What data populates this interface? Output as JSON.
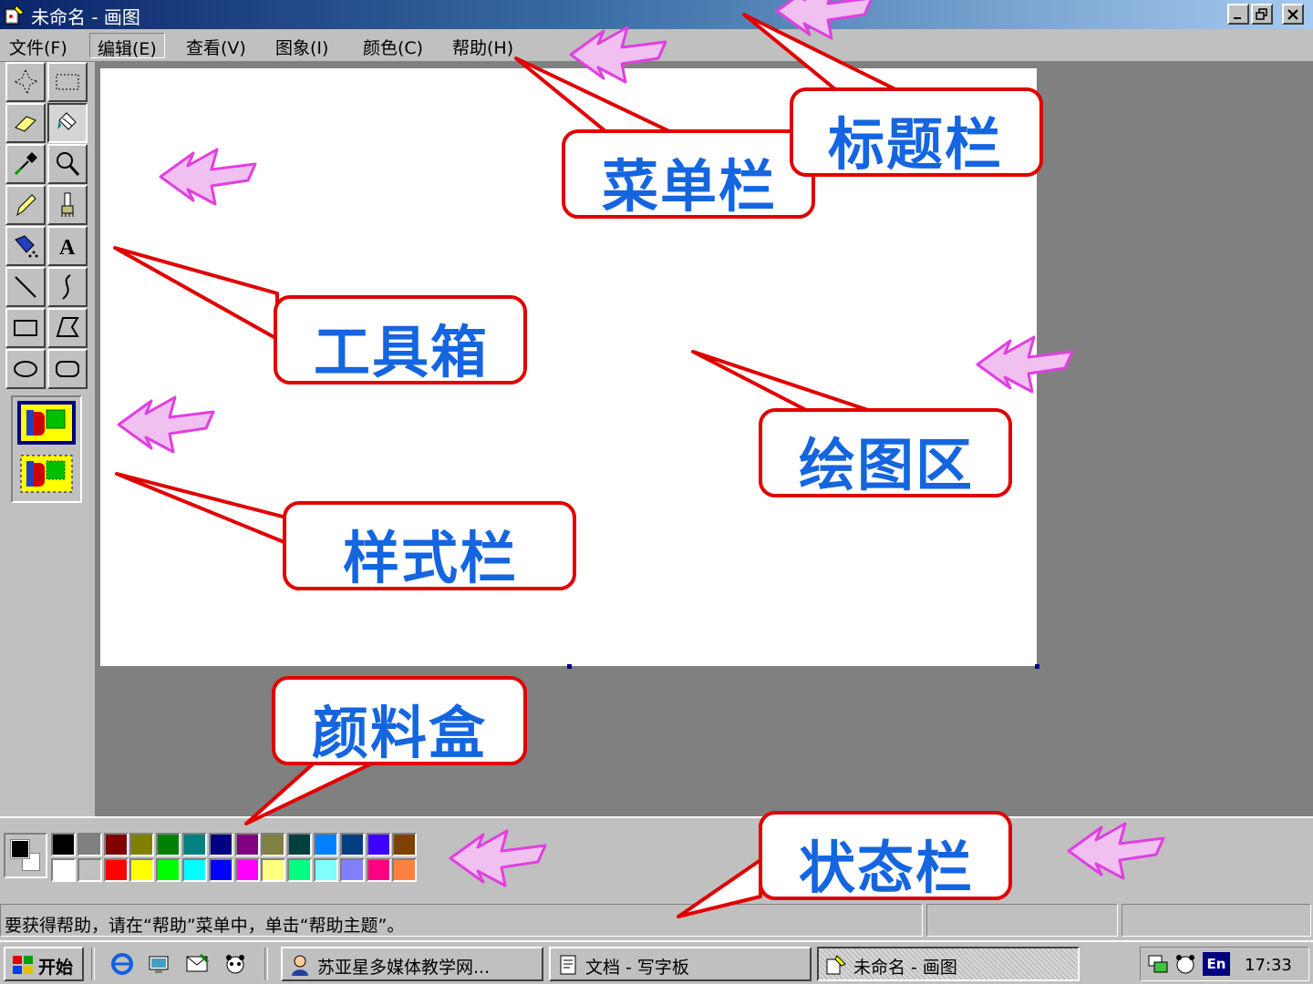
{
  "window": {
    "title": "未命名 - 画图",
    "controls": [
      "minimize",
      "restore",
      "close"
    ]
  },
  "menu": {
    "items": [
      "文件(F)",
      "编辑(E)",
      "查看(V)",
      "图象(I)",
      "颜色(C)",
      "帮助(H)"
    ]
  },
  "toolbox": {
    "tools": [
      "free-select",
      "rect-select",
      "eraser",
      "fill",
      "color-picker",
      "magnifier",
      "pencil",
      "brush",
      "airbrush",
      "text",
      "line",
      "curve",
      "rectangle",
      "polygon",
      "ellipse",
      "rounded-rect"
    ]
  },
  "palette": {
    "foreground": "#000000",
    "background": "#ffffff",
    "top_row": [
      "#000000",
      "#808080",
      "#800000",
      "#808000",
      "#008000",
      "#008080",
      "#000080",
      "#800080",
      "#808040",
      "#004040",
      "#0080ff",
      "#004080",
      "#4000ff",
      "#804000"
    ],
    "bottom_row": [
      "#ffffff",
      "#c0c0c0",
      "#ff0000",
      "#ffff00",
      "#00ff00",
      "#00ffff",
      "#0000ff",
      "#ff00ff",
      "#ffff80",
      "#00ff80",
      "#80ffff",
      "#8080ff",
      "#ff0080",
      "#ff8040"
    ]
  },
  "statusbar": {
    "text": "要获得帮助，请在“帮助”菜单中，单击“帮助主题”。"
  },
  "taskbar": {
    "start_label": "开始",
    "tasks": [
      "苏亚星多媒体教学网...",
      "文档 - 写字板",
      "未命名 - 画图"
    ],
    "clock": "17:33",
    "ime": "En"
  },
  "annotations": {
    "title_bar": "标题栏",
    "menu_bar": "菜单栏",
    "toolbox": "工具箱",
    "canvas": "绘图区",
    "style_bar": "样式栏",
    "palette": "颜料盒",
    "status_bar": "状态栏"
  },
  "colors": {
    "callout_border": "#e00000",
    "callout_text": "#1565e0",
    "arrow": "#e040e0"
  }
}
